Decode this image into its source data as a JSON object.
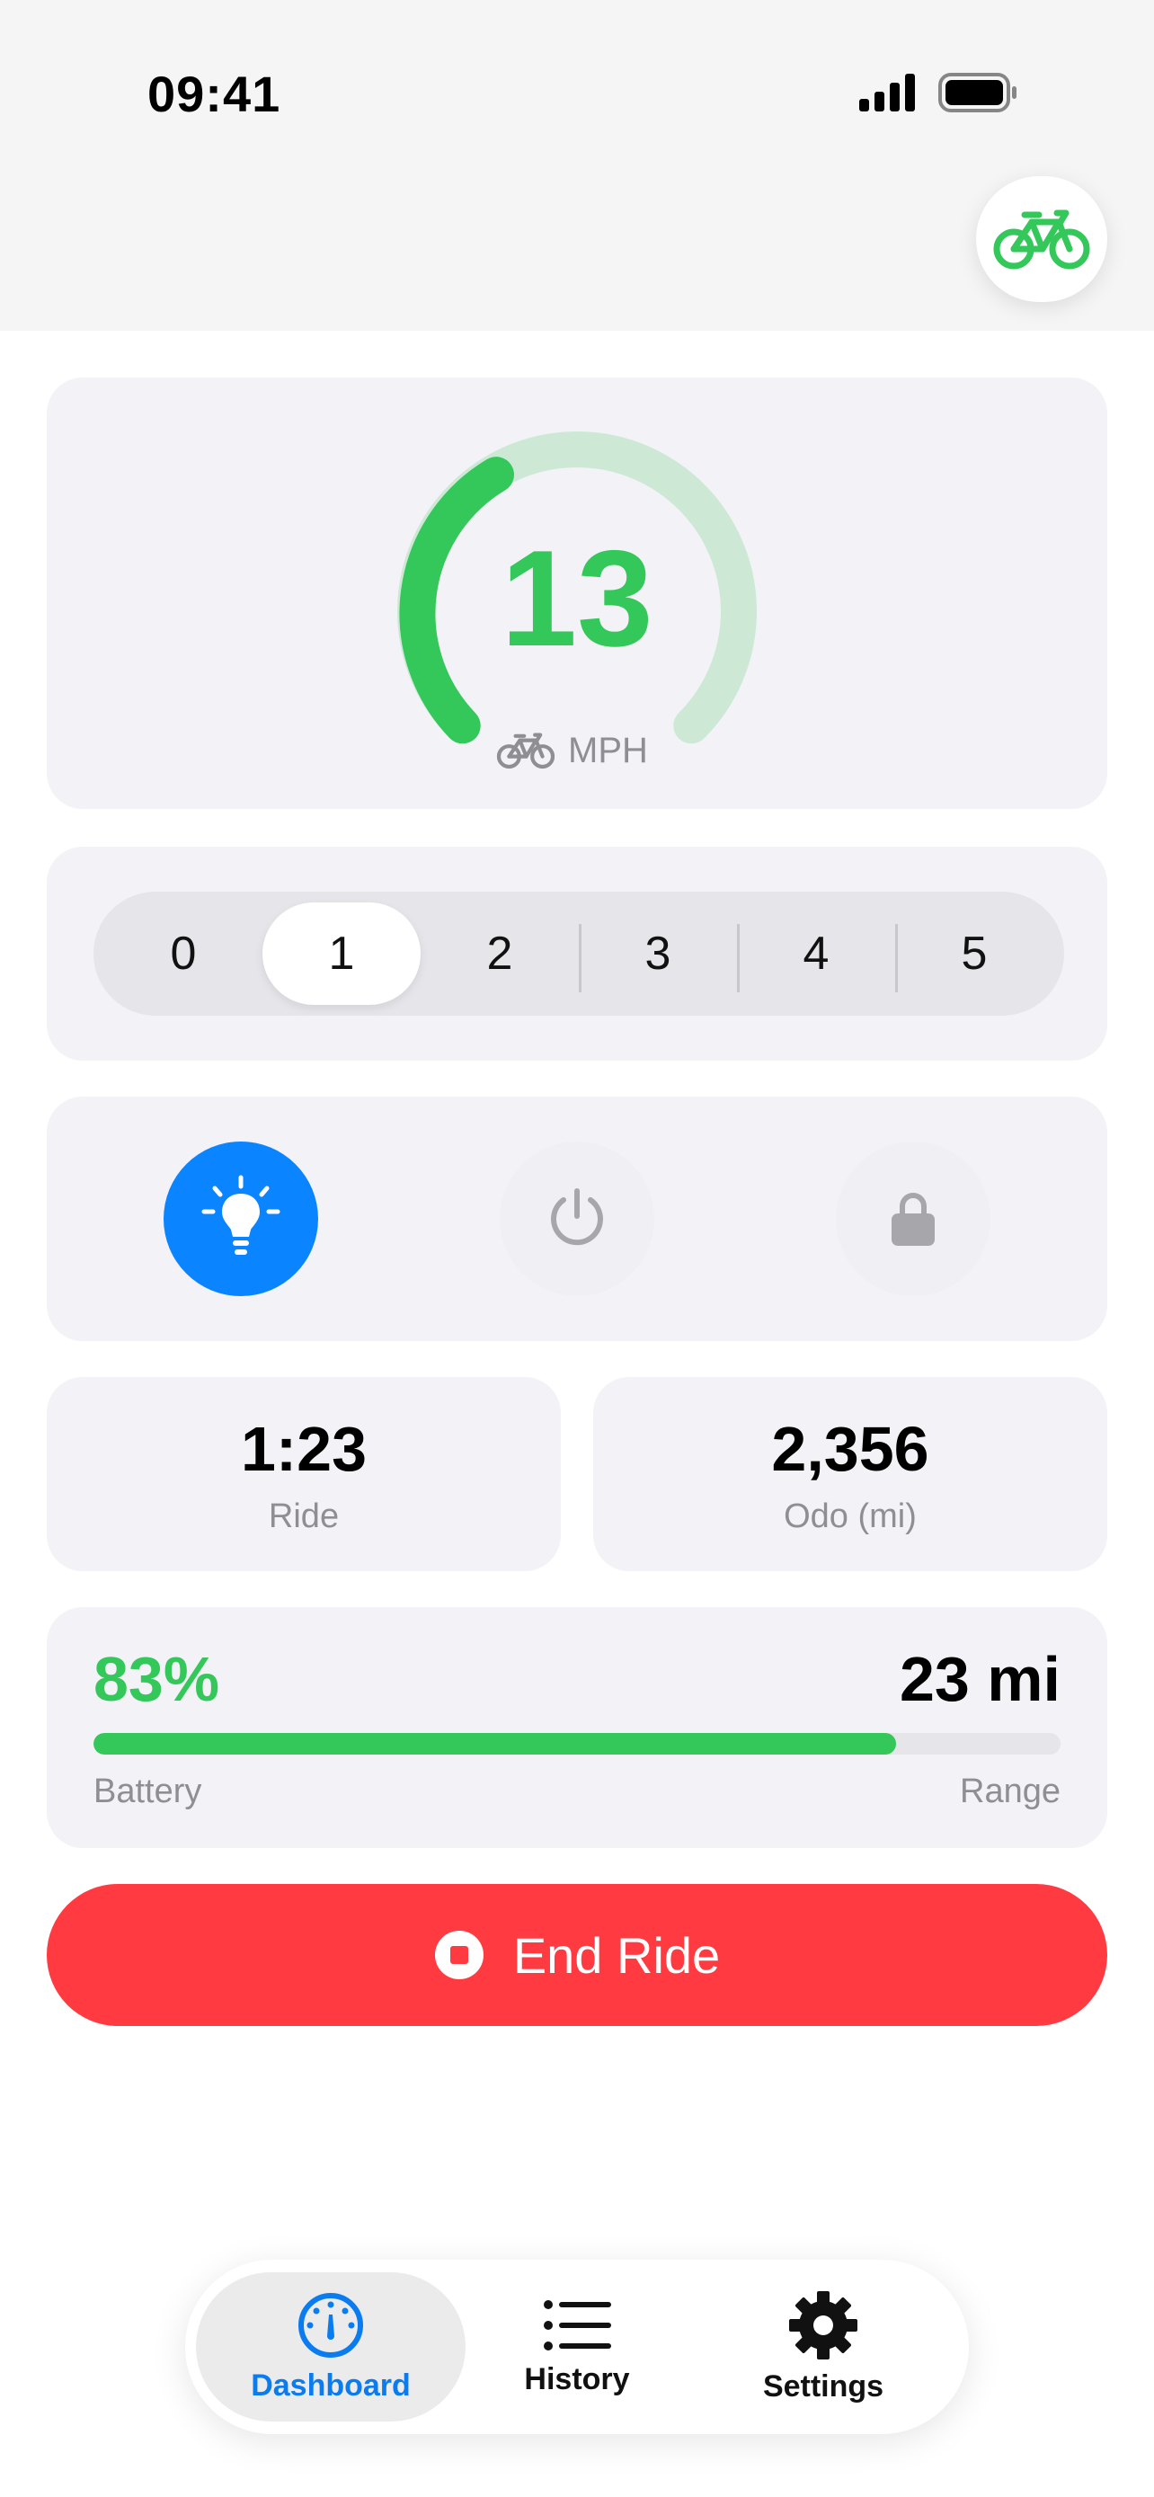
{
  "status_bar": {
    "time": "09:41"
  },
  "speed": {
    "value": "13",
    "unit": "MPH",
    "level": 0.52
  },
  "assist": {
    "options": [
      "0",
      "1",
      "2",
      "3",
      "4",
      "5"
    ],
    "selected": "1"
  },
  "controls": {
    "light": {
      "icon": "lightbulb-icon",
      "active": true
    },
    "power": {
      "icon": "power-icon",
      "active": false
    },
    "lock": {
      "icon": "lock-icon",
      "active": false
    }
  },
  "stats": {
    "ride_time": {
      "value": "1:23",
      "label": "Ride"
    },
    "odometer": {
      "value": "2,356",
      "label": "Odo (mi)"
    }
  },
  "battery": {
    "percent_label": "83%",
    "percent": 0.83,
    "range": "23 mi",
    "battery_label": "Battery",
    "range_label": "Range"
  },
  "end_ride": {
    "label": "End Ride"
  },
  "tabs": [
    {
      "label": "Dashboard",
      "icon": "gauge-icon",
      "active": true
    },
    {
      "label": "History",
      "icon": "list-icon",
      "active": false
    },
    {
      "label": "Settings",
      "icon": "gear-icon",
      "active": false
    }
  ],
  "colors": {
    "accent_green": "#34c759",
    "accent_blue": "#0a84ff",
    "end_ride_red": "#ff3a40",
    "card_bg": "#f2f2f7"
  }
}
